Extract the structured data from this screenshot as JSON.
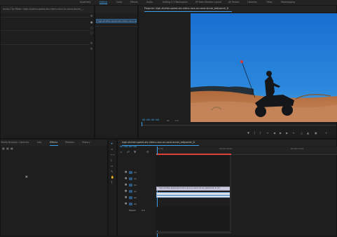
{
  "workspaces": {
    "items": [
      "Assembly",
      "Editing",
      "Color",
      "Effects",
      "Audio",
      "Editing 2.1 Workspace",
      "SP Ram Monitor Layout",
      "All Panels",
      "Libraries",
      "Titles",
      "Metalogging"
    ],
    "active_index": 1
  },
  "source_panel": {
    "tabs": [
      "Audio Clip Mixer: high-shutter-speed-atv-riders-race-on-sand-dunes_..."
    ],
    "project_item": "high-shutter-speed-atv-riders-race-on-sand-dunes_..."
  },
  "program_monitor": {
    "tab_label": "Program: high-shutter-speed-atv-riders-race-on-sand-dunes_bdtpsmdr_D",
    "timecode": "00:00:00:00",
    "fit_label": "Fit",
    "quality_label": "Full"
  },
  "effects_panel": {
    "tabs": [
      "Media Browser",
      "Libraries",
      "Info",
      "Effects",
      "Markers",
      "History"
    ],
    "active_tab": "Effects"
  },
  "timeline": {
    "tab_label": "high-shutter-speed-atv-riders-race-on-sand-dunes_bdtpsmdr_D",
    "timecode": "00:00:00:00",
    "ruler": [
      "00:00",
      "00:00:05:00",
      "00:00:10:00"
    ],
    "tracks": [
      {
        "name": "V3"
      },
      {
        "name": "V2"
      },
      {
        "name": "V1"
      },
      {
        "name": "A1"
      },
      {
        "name": "A2"
      },
      {
        "name": "A3"
      }
    ],
    "master_label": "Master",
    "master_value": "0.0",
    "clip_label": "high-shutter-speed-atv-riders-race-on-sand-dunes_bdtpsmdr_D [V]"
  },
  "colors": {
    "accent": "#3b9fe8",
    "panel": "#1e1e1e",
    "sky": "#1f7fd2"
  },
  "icons": [
    "wrench-icon",
    "play-icon",
    "step-back-icon",
    "step-forward-icon",
    "camera-icon",
    "plus-icon"
  ]
}
